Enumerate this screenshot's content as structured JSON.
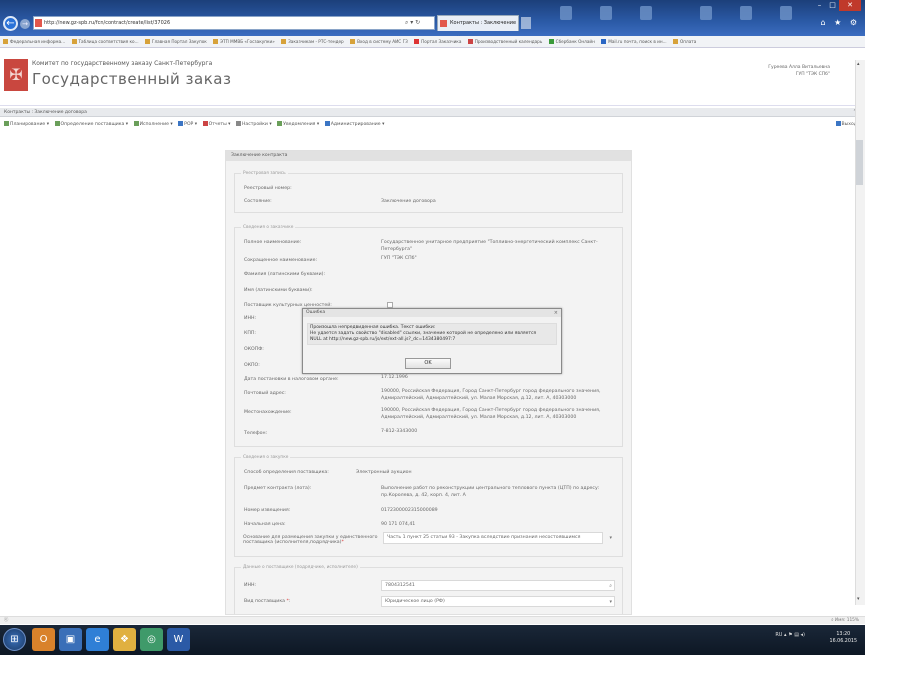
{
  "browser": {
    "address_url": "http://new.gz-spb.ru/fcn/contract/create/list/37026",
    "address_tools": "⌕ ▾ ↻",
    "tab_title": "Контракты : Заключение ...",
    "tab_close": "×",
    "window_buttons": [
      "–",
      "□",
      "✕"
    ],
    "toolbar_icons": "⌂ ★ ⚙",
    "favorites": [
      "Федеральная информа...",
      "Таблица соответствия ко...",
      "Главная Портал Закупок",
      "ЭТП ММВБ «Госзакупки»",
      "Заказчикам - РТС-тендер",
      "Вход в систему АИС ГЗ",
      "Портал Заказчика",
      "Производственный календарь",
      "Сбербанк Онлайн",
      "Mail.ru почта, поиск в ин...",
      "Оплата"
    ]
  },
  "header": {
    "org": "Комитет по государственному заказу Санкт-Петербурга",
    "brand": "Государственный заказ",
    "logo_glyph": "✠",
    "user_name": "Гуреева Алла Витальевна",
    "user_org": "ГУП \"ТЭК СПб\""
  },
  "section": {
    "breadcrumb": "Контракты : Заключение договора",
    "pin": "⌃"
  },
  "menu": {
    "items": [
      "Планирование ▾",
      "Определение поставщика ▾",
      "Исполнение ▾",
      "РОР ▾",
      "Отчеты ▾",
      "Настройки ▾",
      "Уведомления ▾",
      "Администрирование ▾"
    ],
    "exit": "Выход"
  },
  "panel": {
    "title": "Заключение контракта",
    "registry": {
      "legend": "Реестровая запись",
      "reg_num_label": "Реестровый номер:",
      "status_label": "Состояние:",
      "status_value": "Заключение договора"
    },
    "customer": {
      "legend": "Сведения о заказчике",
      "full_name_label": "Полное наименование:",
      "full_name_value": "Государственное унитарное предприятие \"Топливно-энергетический комплекс Санкт-Петербурга\"",
      "short_name_label": "Сокращенное наименование:",
      "short_name_value": "ГУП \"ТЭК СПб\"",
      "surname_label": "Фамилия (латинскими буквами):",
      "name_label": "Имя (латинскими буквами):",
      "culture_label": "Поставщик культурных ценностей:",
      "inn_label": "ИНН:",
      "kpp_label": "КПП:",
      "okopf_label": "ОКОПФ:",
      "okpo_label": "ОКПО:",
      "reg_date_label": "Дата постановки в налоговом органе:",
      "reg_date_value": "17.12.1996",
      "postal_label": "Почтовый адрес:",
      "postal_value": "190000, Российская Федерация, Город Санкт-Петербург город федерального значения, Адмиралтейский, Адмиралтейский, ул. Малая Морская, д.12, лит. А, 40303000",
      "location_label": "Местонахождение:",
      "location_value": "190000, Российская Федерация, Город Санкт-Петербург город федерального значения, Адмиралтейский, Адмиралтейский, ул. Малая Морская, д.12, лит. А, 40303000",
      "phone_label": "Телефон:",
      "phone_value": "7-812-3343000"
    },
    "purchase": {
      "legend": "Сведения о закупке",
      "method_label": "Способ определения поставщика:",
      "method_value": "Электронный аукцион",
      "subject_label": "Предмет контракта (лота):",
      "subject_value": "Выполнение работ по реконструкции центрального теплового пункта (ЦТП) по адресу: пр.Королева, д. 42, корп. 4, лит. А",
      "notice_label": "Номер извещения:",
      "notice_value": "0172300002315000089",
      "price_label": "Начальная цена:",
      "price_value": "90 171 074,41",
      "basis_label_1": "Основание для размещения закупки у единственного",
      "basis_label_2": "поставщика (исполнителя,подрядчика)",
      "basis_value": "Часть 1 пункт 25 статьи 93 - Закупка вследствие признания несостоявшимся"
    },
    "supplier": {
      "legend": "Данные о поставщике (подрядчике, исполнителе)",
      "inn_label": "ИНН:",
      "inn_value": "7804312541",
      "type_label": "Вид поставщика",
      "type_value": "Юридическое лицо (РФ)"
    }
  },
  "dialog": {
    "title": "Ошибка",
    "close": "×",
    "line1": "Произошла непредвиденная ошибка. Текст ошибки:",
    "line2": "Не удается задать свойство \"disabled\" ссылки, значение которой не определено или является",
    "line3": "NULL at http://new.gz-spb.ru/js/ext/ext-all.js?_dc=1434380497:7",
    "ok": "OK"
  },
  "status": {
    "left": "ⓔ",
    "right": "⌕ Имя: 115%"
  },
  "taskbar": {
    "start": "⊞",
    "apps": [
      "O",
      "▣",
      "e",
      "❖",
      "◎",
      "W"
    ],
    "app_colors": [
      "#d9822b",
      "#3a6fb8",
      "#2f7fd6",
      "#e0b040",
      "#3f9a6a",
      "#2b5aa6"
    ],
    "tray": "RU  ▴  ⚑  ▤  ◂)",
    "time": "13:20",
    "date": "16.06.2015"
  },
  "colors": {
    "accent": "#c9473f",
    "titlebar": "#2b5aa6",
    "taskbar": "#0d1724"
  }
}
